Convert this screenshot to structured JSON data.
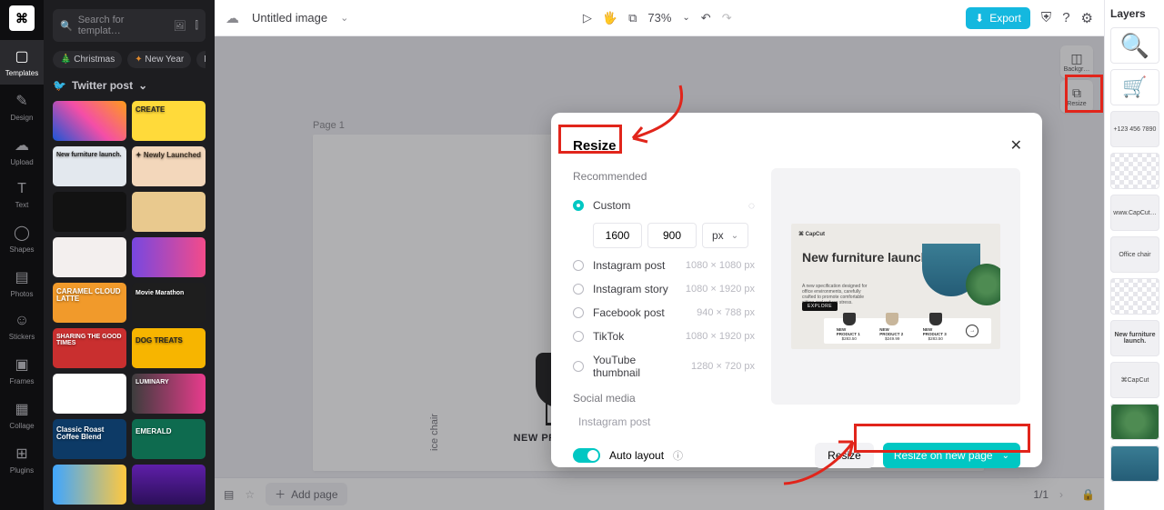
{
  "rail": {
    "items": [
      {
        "icon": "▢",
        "label": "Templates",
        "active": true
      },
      {
        "icon": "✎",
        "label": "Design"
      },
      {
        "icon": "☁",
        "label": "Upload"
      },
      {
        "icon": "T",
        "label": "Text"
      },
      {
        "icon": "◯",
        "label": "Shapes"
      },
      {
        "icon": "▤",
        "label": "Photos"
      },
      {
        "icon": "☺",
        "label": "Stickers"
      },
      {
        "icon": "▣",
        "label": "Frames"
      },
      {
        "icon": "▦",
        "label": "Collage"
      },
      {
        "icon": "⊞",
        "label": "Plugins"
      }
    ]
  },
  "templates": {
    "search_placeholder": "Search for templat…",
    "chips": [
      {
        "icon_class": "tree",
        "icon": "🎄",
        "label": "Christmas"
      },
      {
        "icon_class": "flare",
        "icon": "✦",
        "label": "New Year"
      },
      {
        "icon_class": "",
        "icon": "",
        "label": "Mo"
      }
    ],
    "section": {
      "icon": "🐦",
      "label": "Twitter post"
    }
  },
  "topbar": {
    "title": "Untitled image",
    "zoom": "73%",
    "export": "Export"
  },
  "right_actions": {
    "items": [
      {
        "icon": "◫",
        "label": "Backgr…"
      },
      {
        "icon": "⧉",
        "label": "Resize"
      }
    ]
  },
  "page": {
    "label": "Page 1",
    "url": "www.CapCut.com",
    "side_label": "ice chair",
    "products": [
      "NEW PRODUCT 1",
      "NEW PRODUCT 2",
      "NEW PRODUCT 3"
    ],
    "bottom": {
      "add": "Add page",
      "pager": "1/1"
    }
  },
  "layers": {
    "title": "Layers",
    "items": [
      {
        "label": ""
      },
      {
        "label": ""
      },
      {
        "label": "+123 456 7890"
      },
      {
        "label": ""
      },
      {
        "label": "www.CapCut…"
      },
      {
        "label": "Office chair"
      },
      {
        "label": ""
      },
      {
        "label": "New furniture launch."
      },
      {
        "label": "CapCut"
      },
      {
        "label": ""
      },
      {
        "label": ""
      }
    ]
  },
  "modal": {
    "title": "Resize",
    "section_recommended": "Recommended",
    "custom": "Custom",
    "width": "1600",
    "height": "900",
    "unit": "px",
    "presets": [
      {
        "name": "Instagram post",
        "dim": "1080 × 1080 px"
      },
      {
        "name": "Instagram story",
        "dim": "1080 × 1920 px"
      },
      {
        "name": "Facebook post",
        "dim": "940 × 788 px"
      },
      {
        "name": "TikTok",
        "dim": "1080 × 1920 px"
      },
      {
        "name": "YouTube thumbnail",
        "dim": "1280 × 720 px"
      }
    ],
    "section_social": "Social media",
    "social_item": "Instagram post",
    "auto_layout": "Auto layout",
    "btn_resize": "Resize",
    "btn_new": "Resize on new page",
    "preview": {
      "brand": "CapCut",
      "title": "New furniture launch.",
      "cta": "EXPLORE",
      "p1": {
        "name": "NEW PRODUCT 1",
        "price": "$283.50"
      },
      "p2": {
        "name": "NEW PRODUCT 2",
        "price": "$249.99"
      },
      "p3": {
        "name": "NEW PRODUCT 3",
        "price": "$283.50"
      }
    }
  }
}
